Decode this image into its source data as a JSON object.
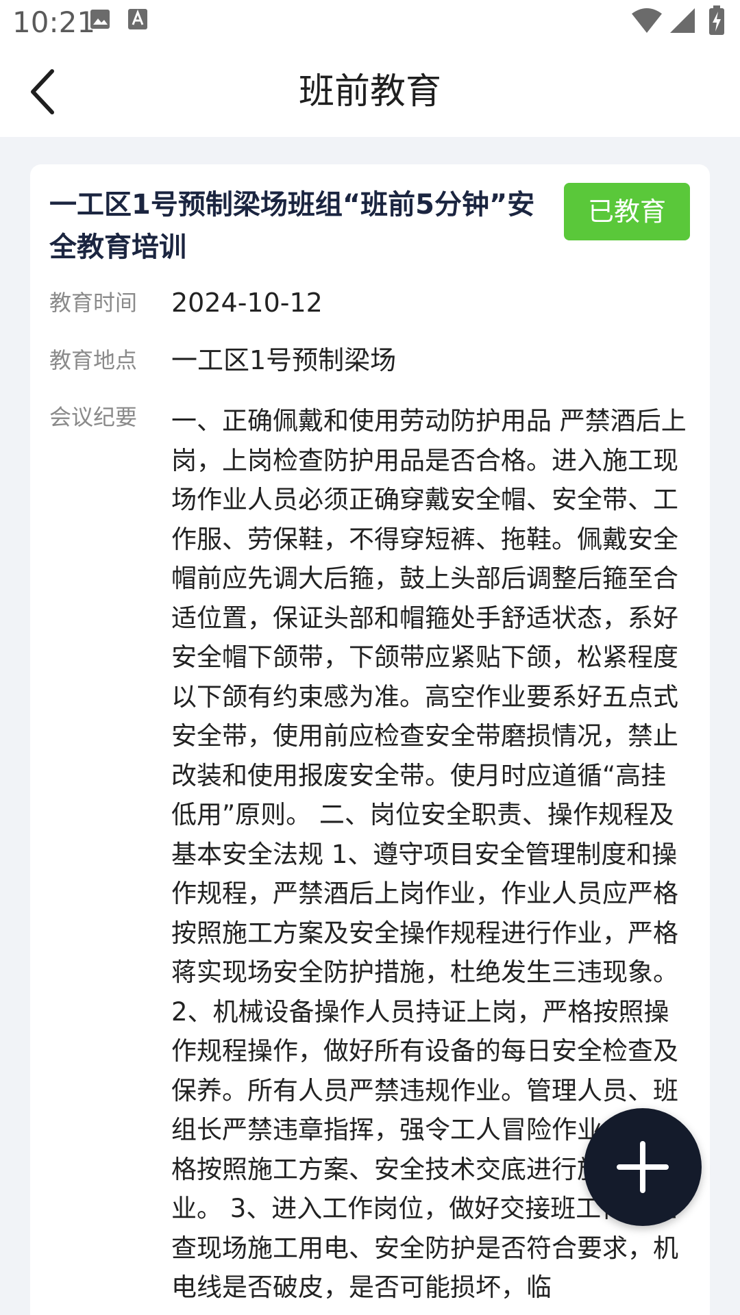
{
  "status_bar": {
    "time": "10:21",
    "icons": [
      "gallery-icon",
      "text-a-icon",
      "wifi-icon",
      "signal-icon",
      "battery-charging-icon"
    ]
  },
  "header": {
    "title": "班前教育",
    "back_icon": "chevron-left-icon"
  },
  "record": {
    "title": "一工区1号预制梁场班组“班前5分钟”安全教育培训",
    "status": "已教育",
    "status_color": "#5ac83a",
    "fields": [
      {
        "label": "教育时间",
        "value": "2024-10-12"
      },
      {
        "label": "教育地点",
        "value": "一工区1号预制梁场"
      },
      {
        "label": "会议纪要",
        "value": "一、正确佩戴和使用劳动防护用品 严禁酒后上岗，上岗检查防护用品是否合格。进入施工现场作业人员必须正确穿戴安全帽、安全带、工作服、劳保鞋，不得穿短裤、拖鞋。佩戴安全帽前应先调大后箍，鼓上头部后调整后箍至合适位置，保证头部和帽箍处手舒适状态，系好安全帽下颌带，下颌带应紧贴下颌，松紧程度以下颌有约束感为准。高空作业要系好五点式安全带，使用前应检查安全带磨损情况，禁止改装和使用报废安全带。使月时应道循“高挂低用”原则。 二、岗位安全职责、操作规程及基本安全法规 1、遵守项目安全管理制度和操作规程，严禁酒后上岗作业，作业人员应严格按照施工方案及安全操作规程进行作业，严格蒋实现场安全防护措施，杜绝发生三违现象。 2、机械设备操作人员持证上岗，严格按照操作规程操作，做好所有设备的每日安全检查及保养。所有人员严禁违规作业。管理人员、班组长严禁违章指挥，强令工人冒险作业，要严格按照施工方案、安全技术交底进行施工作业。 3、进入工作岗位，做好交接班工作，检查现场施工用电、安全防护是否符合要求，机电线是否破皮，是否可能损坏，临"
      }
    ]
  },
  "fab": {
    "icon": "plus-icon",
    "color": "#141b2b"
  }
}
